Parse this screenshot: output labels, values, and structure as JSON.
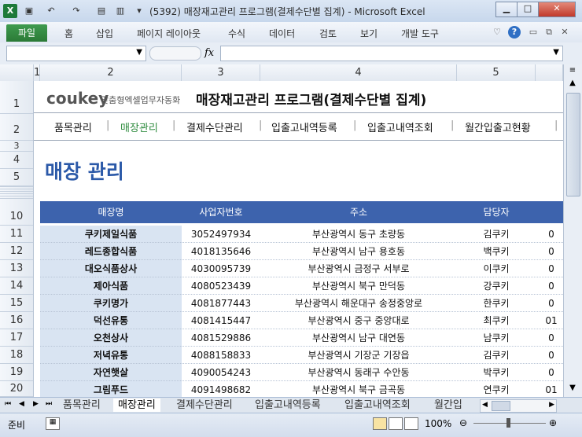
{
  "window": {
    "title": "(5392) 매장재고관리 프로그램(결제수단별 집계) - Microsoft Excel"
  },
  "ribbon": {
    "file_tab": "파일",
    "tabs": [
      "홈",
      "삽입",
      "페이지 레이아웃",
      "수식",
      "데이터",
      "검토",
      "보기",
      "개발 도구"
    ]
  },
  "formula_bar": {
    "fx": "fx"
  },
  "columns": [
    "1",
    "2",
    "3",
    "4",
    "5"
  ],
  "rows": [
    "1",
    "2",
    "3",
    "4",
    "5",
    "10",
    "11",
    "12",
    "13",
    "14",
    "15",
    "16",
    "17",
    "18",
    "19",
    "20"
  ],
  "sheet": {
    "logo_brand": "coukey",
    "logo_sub": "맞춤형엑셀업무자동화",
    "app_title": "매장재고관리 프로그램(결제수단별 집계)",
    "nav": [
      "품목관리",
      "매장관리",
      "결제수단관리",
      "입출고내역등록",
      "입출고내역조회",
      "월간입출고현황"
    ],
    "nav_active": 1,
    "page_title": "매장 관리",
    "headers": [
      "매장명",
      "사업자번호",
      "주소",
      "담당자"
    ],
    "records": [
      [
        "쿠키제일식품",
        "3052497934",
        "부산광역시 동구 초량동",
        "김쿠키",
        "0"
      ],
      [
        "레드종합식품",
        "4018135646",
        "부산광역시 남구 용호동",
        "백쿠키",
        "0"
      ],
      [
        "대오식품상사",
        "4030095739",
        "부산광역시 금정구 서부로",
        "이쿠키",
        "0"
      ],
      [
        "제아식품",
        "4080523439",
        "부산광역시 북구 만덕동",
        "강쿠키",
        "0"
      ],
      [
        "쿠키명가",
        "4081877443",
        "부산광역시 해운대구 송정중앙로",
        "한쿠키",
        "0"
      ],
      [
        "덕선유통",
        "4081415447",
        "부산광역시 중구 중앙대로",
        "최쿠키",
        "01"
      ],
      [
        "오천상사",
        "4081529886",
        "부산광역시 남구 대연동",
        "남쿠키",
        "0"
      ],
      [
        "저녁유통",
        "4088158833",
        "부산광역시 기장군 기장읍",
        "김쿠키",
        "0"
      ],
      [
        "자연햇살",
        "4090054243",
        "부산광역시 동래구 수안동",
        "박쿠키",
        "0"
      ],
      [
        "그림푸드",
        "4091498682",
        "부산광역시 북구 금곡동",
        "연쿠키",
        "01"
      ]
    ]
  },
  "sheet_tabs": [
    "품목관리",
    "매장관리",
    "결제수단관리",
    "입출고내역등록",
    "입출고내역조회",
    "월간입"
  ],
  "active_sheet_tab": 1,
  "status": {
    "ready": "준비",
    "zoom": "100%"
  },
  "colors": {
    "header_blue": "#3d63ad",
    "title_blue": "#2b59a8",
    "name_cell": "#d9e4f2",
    "nav_active": "#2e8b3e",
    "file_tab": "#2b7a36"
  }
}
